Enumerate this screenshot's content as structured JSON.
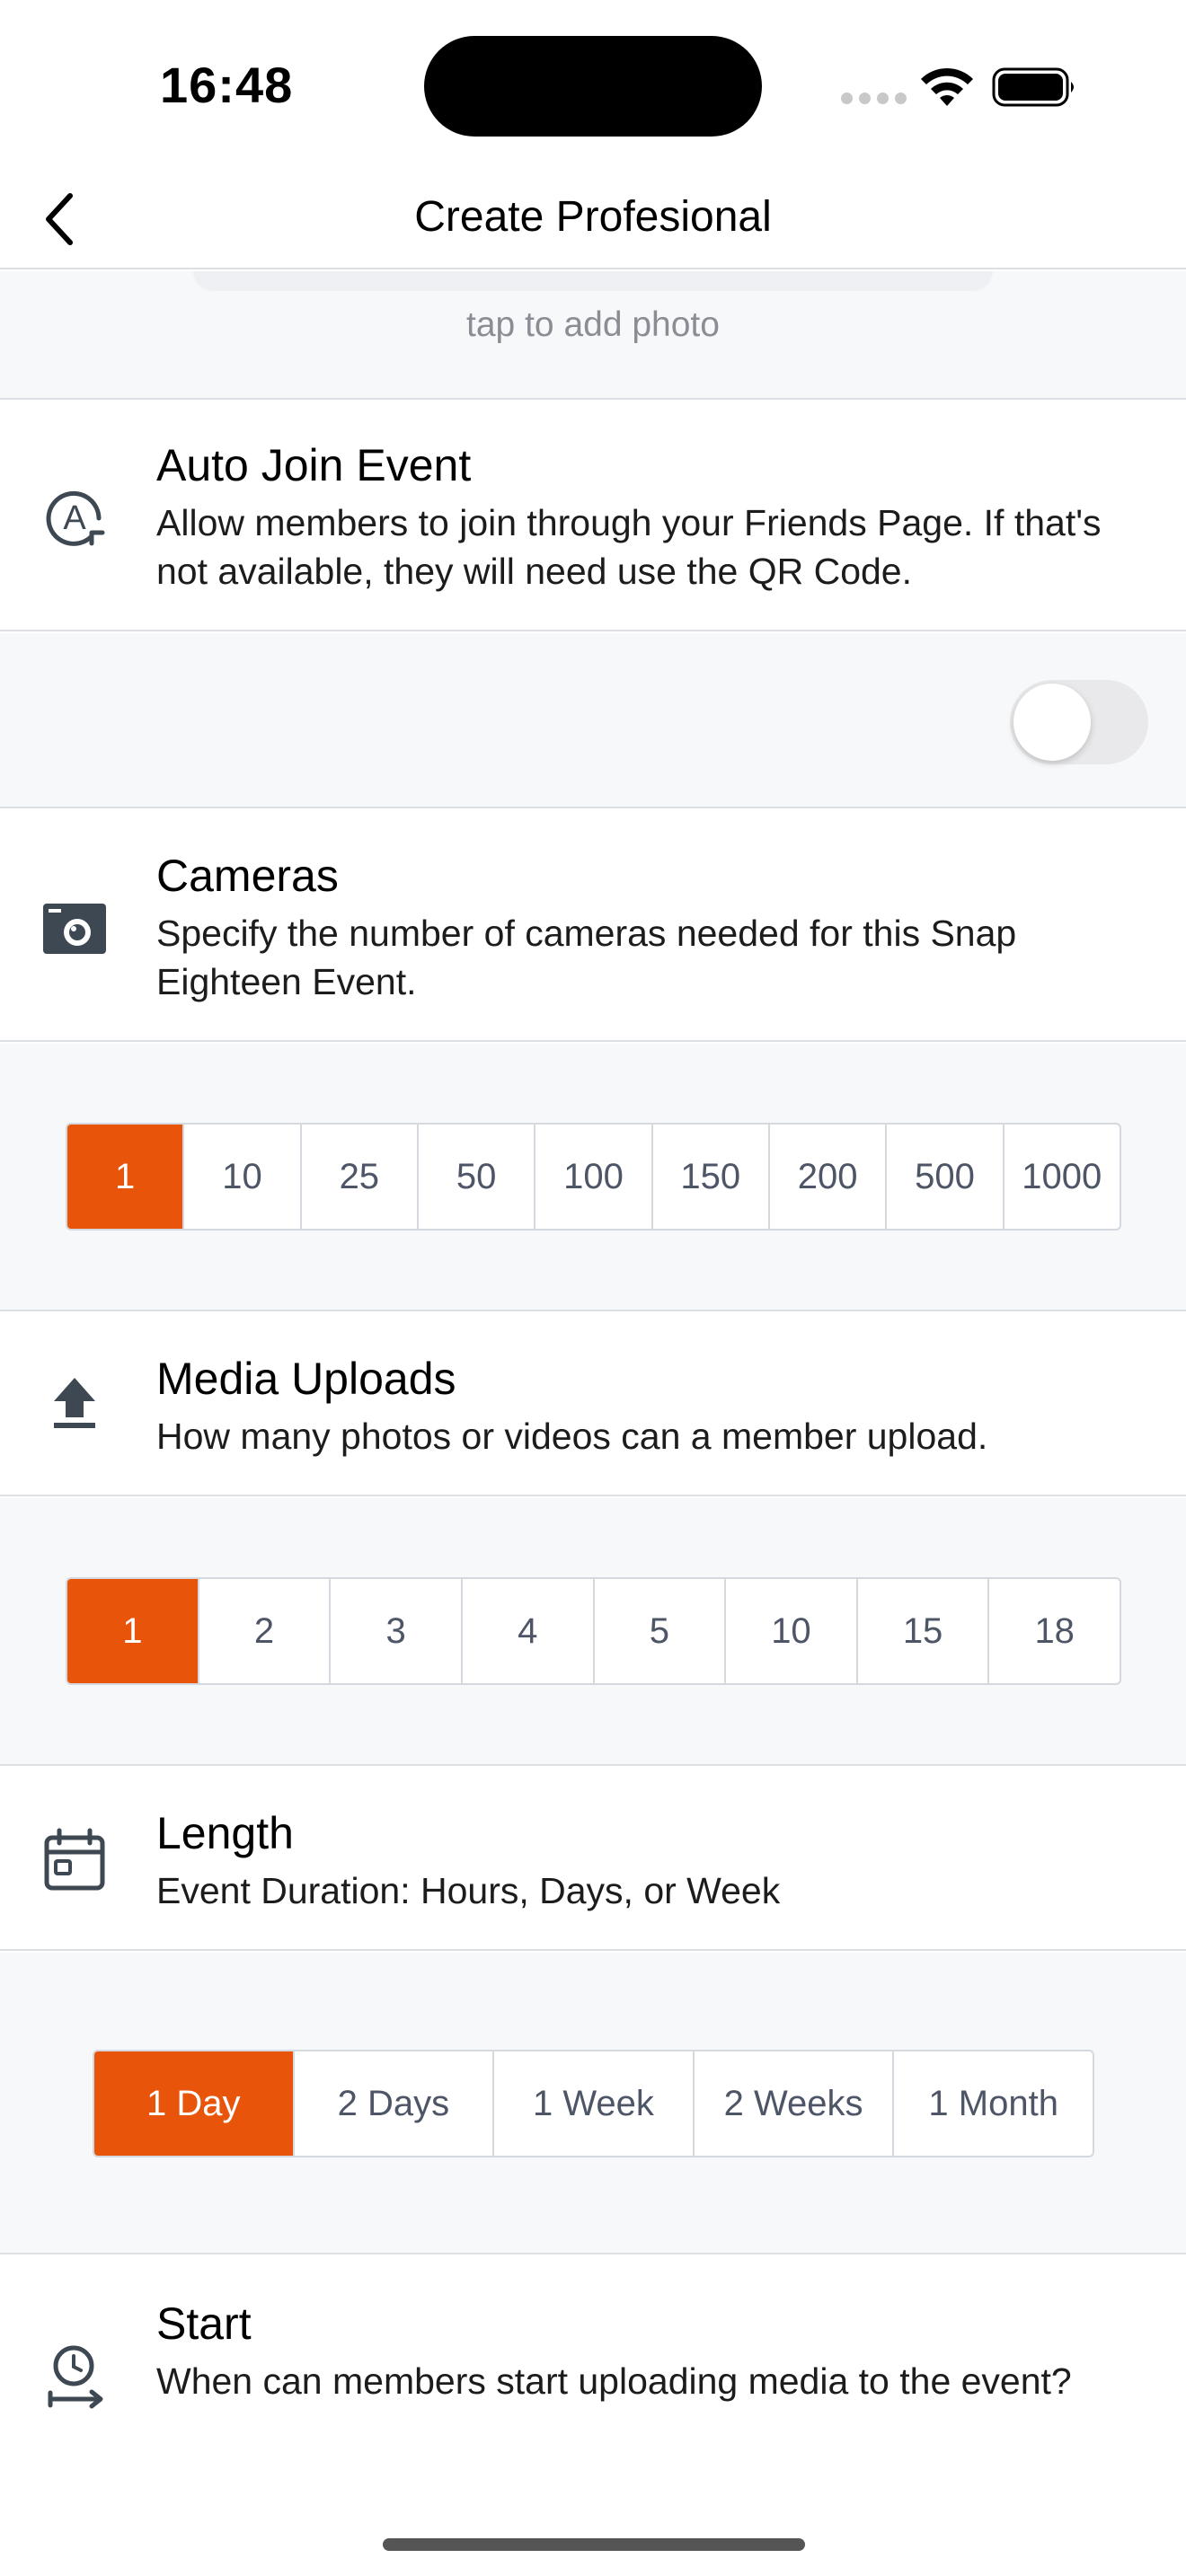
{
  "status_bar": {
    "time": "16:48"
  },
  "nav": {
    "title": "Create Profesional"
  },
  "photo": {
    "hint": "tap to add photo"
  },
  "auto_join": {
    "title": "Auto Join Event",
    "description": "Allow members to join through your Friends Page. If that's not available, they will need use the QR Code.",
    "toggle_on": false
  },
  "cameras": {
    "title": "Cameras",
    "description": "Specify the number of cameras needed for this Snap Eighteen Event.",
    "options": [
      "1",
      "10",
      "25",
      "50",
      "100",
      "150",
      "200",
      "500",
      "1000"
    ],
    "selected": "1"
  },
  "media_uploads": {
    "title": "Media Uploads",
    "description": "How many photos or videos can a member upload.",
    "options": [
      "1",
      "2",
      "3",
      "4",
      "5",
      "10",
      "15",
      "18"
    ],
    "selected": "1"
  },
  "length": {
    "title": "Length",
    "description": "Event Duration: Hours, Days, or Week",
    "options": [
      "1 Day",
      "2 Days",
      "1 Week",
      "2 Weeks",
      "1 Month"
    ],
    "selected": "1 Day"
  },
  "start": {
    "title": "Start",
    "description": "When can members start uploading media to the event?"
  },
  "colors": {
    "accent": "#e8540a",
    "background_muted": "#f7f8fa",
    "divider": "#dcdfe4"
  },
  "icons": {
    "back": "chevron-left-icon",
    "auto_join": "auto-join-icon",
    "cameras": "camera-icon",
    "media_uploads": "upload-icon",
    "length": "calendar-icon",
    "start": "clock-arrow-icon"
  }
}
